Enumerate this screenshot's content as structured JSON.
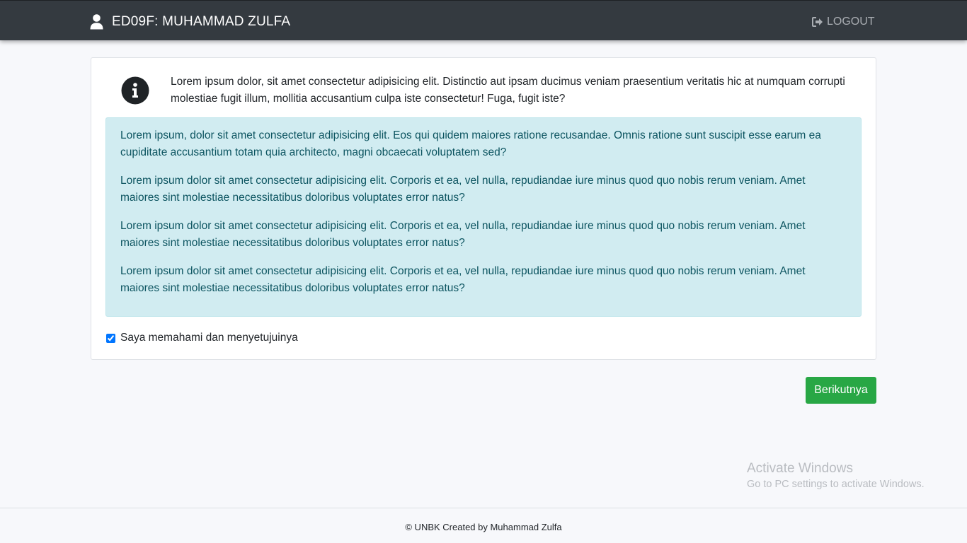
{
  "header": {
    "title": "ED09F: MUHAMMAD ZULFA",
    "logout_label": "LOGOUT",
    "user_icon": "user-icon",
    "logout_icon": "sign-out-icon"
  },
  "card": {
    "info_icon": "info-circle-icon",
    "intro_text": "Lorem ipsum dolor, sit amet consectetur adipisicing elit. Distinctio aut ipsam ducimus veniam praesentium veritatis hic at numquam corrupti molestiae fugit illum, mollitia accusantium culpa iste consectetur! Fuga, fugit iste?",
    "alert_paragraphs": [
      "Lorem ipsum, dolor sit amet consectetur adipisicing elit. Eos qui quidem maiores ratione recusandae. Omnis ratione sunt suscipit esse earum ea cupiditate accusantium totam quia architecto, magni obcaecati voluptatem sed?",
      "Lorem ipsum dolor sit amet consectetur adipisicing elit. Corporis et ea, vel nulla, repudiandae iure minus quod quo nobis rerum veniam. Amet maiores sint molestiae necessitatibus doloribus voluptates error natus?",
      "Lorem ipsum dolor sit amet consectetur adipisicing elit. Corporis et ea, vel nulla, repudiandae iure minus quod quo nobis rerum veniam. Amet maiores sint molestiae necessitatibus doloribus voluptates error natus?",
      "Lorem ipsum dolor sit amet consectetur adipisicing elit. Corporis et ea, vel nulla, repudiandae iure minus quod quo nobis rerum veniam. Amet maiores sint molestiae necessitatibus doloribus voluptates error natus?"
    ],
    "agree_label": "Saya memahami dan menyetujuinya",
    "agree_checked": true
  },
  "actions": {
    "next_label": "Berikutnya"
  },
  "watermark": {
    "title": "Activate Windows",
    "subtitle": "Go to PC settings to activate Windows."
  },
  "footer": {
    "text": "© UNBK Created by Muhammad Zulfa"
  },
  "colors": {
    "navbar": "#343a40",
    "alert_bg": "#d1ecf1",
    "alert_text": "#0c5460",
    "success": "#28a745"
  }
}
